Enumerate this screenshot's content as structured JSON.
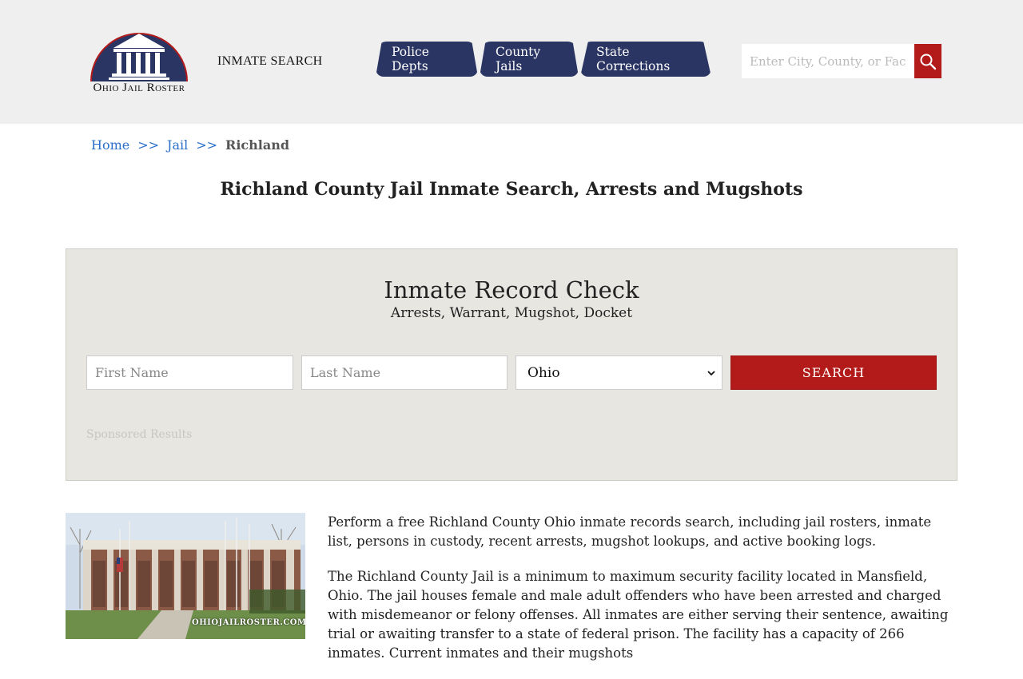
{
  "header": {
    "logo_text": "Ohio Jail Roster",
    "inmate_search_label": "INMATE SEARCH",
    "nav_tabs": [
      "Police Depts",
      "County Jails",
      "State Corrections"
    ],
    "search_placeholder": "Enter City, County, or Facility"
  },
  "breadcrumb": {
    "home": "Home",
    "sep": ">>",
    "jail": "Jail",
    "current": "Richland"
  },
  "page_title": "Richland County Jail Inmate Search, Arrests and Mugshots",
  "record_check": {
    "title": "Inmate Record Check",
    "subtitle": "Arrests, Warrant, Mugshot, Docket",
    "first_name_placeholder": "First Name",
    "last_name_placeholder": "Last Name",
    "state_selected": "Ohio",
    "search_button": "SEARCH",
    "sponsored": "Sponsored Results"
  },
  "photo": {
    "watermark": "OHIOJAILROSTER.COM"
  },
  "content": {
    "paragraphs": [
      "Perform a free Richland County Ohio inmate records search, including jail rosters, inmate list, persons in custody, recent arrests, mugshot lookups, and active booking logs.",
      "The Richland County Jail is a minimum to maximum security facility located in Mansfield, Ohio. The jail houses female and male adult offenders who have been arrested and charged with misdemeanor or felony offenses. All inmates are either serving their sentence, awaiting trial or awaiting transfer to a state of federal prison. The facility has a capacity of 266 inmates. Current inmates and their mugshots"
    ]
  }
}
